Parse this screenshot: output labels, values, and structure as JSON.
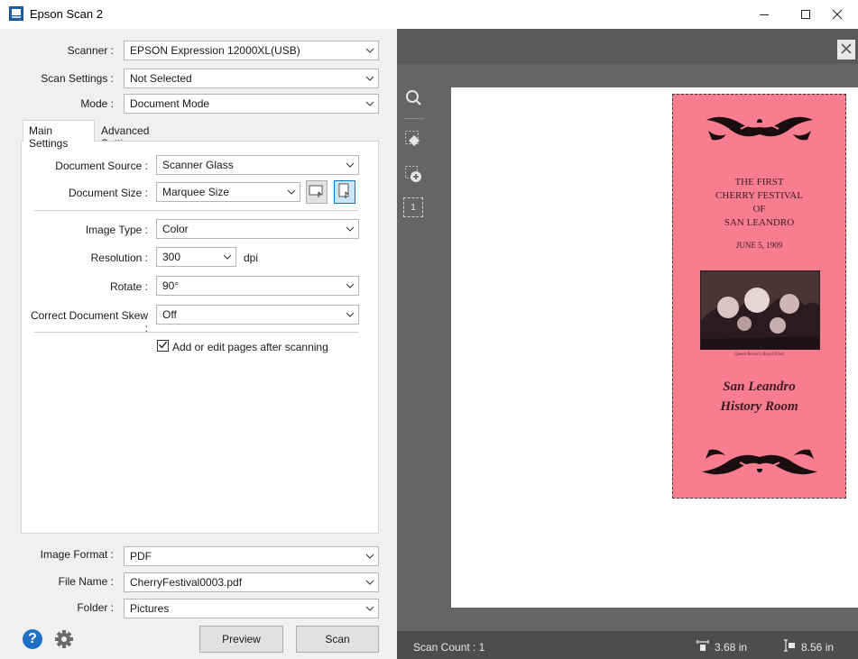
{
  "window": {
    "title": "Epson Scan 2",
    "minimize_glyph": "—",
    "maximize_glyph": "☐",
    "close_glyph": "✕"
  },
  "settings": {
    "scanner_label": "Scanner :",
    "scanner_value": "EPSON Expression 12000XL(USB)",
    "scan_settings_label": "Scan Settings :",
    "scan_settings_value": "Not Selected",
    "mode_label": "Mode :",
    "mode_value": "Document Mode"
  },
  "tabs": [
    "Main Settings",
    "Advanced Settings"
  ],
  "main_settings": {
    "document_source_label": "Document Source :",
    "document_source_value": "Scanner Glass",
    "document_size_label": "Document Size :",
    "document_size_value": "Marquee Size",
    "image_type_label": "Image Type :",
    "image_type_value": "Color",
    "resolution_label": "Resolution :",
    "resolution_value": "300",
    "resolution_unit": "dpi",
    "rotate_label": "Rotate :",
    "rotate_value": "90°",
    "skew_label": "Correct Document Skew :",
    "skew_value": "Off",
    "add_pages_label": "Add or edit pages after scanning",
    "add_pages_checked": true
  },
  "output": {
    "image_format_label": "Image Format :",
    "image_format_value": "PDF",
    "file_name_label": "File Name :",
    "file_name_value": "CherryFestival0003.pdf",
    "folder_label": "Folder :",
    "folder_value": "Pictures"
  },
  "buttons": {
    "preview": "Preview",
    "scan": "Scan",
    "help_glyph": "?"
  },
  "preview": {
    "close_glyph": "✕",
    "tool_page_number": "1",
    "doc_title_line1": "THE FIRST",
    "doc_title_line2": "CHERRY FESTIVAL",
    "doc_title_line3": "OF",
    "doc_title_line4": "SAN LEANDRO",
    "doc_date": "JUNE 5, 1909",
    "doc_caption": "Queen Bessie's Royal Float",
    "doc_footer_line1": "San Leandro",
    "doc_footer_line2": "History Room"
  },
  "status": {
    "scan_count": "Scan Count : 1",
    "width": "3.68 in",
    "height": "8.56 in"
  },
  "colors": {
    "accent": "#0078d7",
    "help_icon": "#1e6fc5",
    "document_pink": "#f87d8f"
  }
}
